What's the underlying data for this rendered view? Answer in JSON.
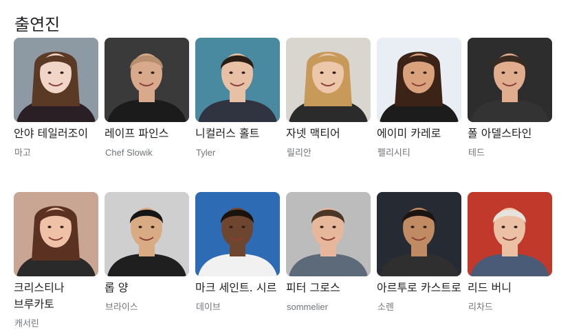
{
  "section": {
    "title": "출연진"
  },
  "cast": [
    {
      "name": "안야 테일러조이",
      "role": "마고",
      "bg": "#8e9aa3",
      "skin": "#f1d6c8",
      "hair": "#5a3a25",
      "shirt": "#2a1f24"
    },
    {
      "name": "레이프 파인스",
      "role": "Chef Slowik",
      "bg": "#3a3a3a",
      "skin": "#d9a98c",
      "hair": "#b88f6e",
      "shirt": "#1b1b1b"
    },
    {
      "name": "니컬러스 홀트",
      "role": "Tyler",
      "bg": "#4a8aa0",
      "skin": "#e8c0a6",
      "hair": "#2a1d16",
      "shirt": "#2f3440"
    },
    {
      "name": "자넷 맥티어",
      "role": "릴리안",
      "bg": "#d9d5cf",
      "skin": "#ecc7a9",
      "hair": "#c79a5a",
      "shirt": "#2b2b2b"
    },
    {
      "name": "에이미 카레로",
      "role": "펠리시티",
      "bg": "#e9eef4",
      "skin": "#d9a27c",
      "hair": "#3b2417",
      "shirt": "#1c1c1c"
    },
    {
      "name": "폴 아델스타인",
      "role": "테드",
      "bg": "#2d2d2d",
      "skin": "#e0ad8e",
      "hair": "#3a2a20",
      "shirt": "#333333"
    },
    {
      "name": "크리스티나 브루카토",
      "role": "캐서린",
      "bg": "#c9a594",
      "skin": "#efc2a8",
      "hair": "#5b3222",
      "shirt": "#2a2a2a"
    },
    {
      "name": "롭 양",
      "role": "브라이스",
      "bg": "#cfcfcf",
      "skin": "#d9ab84",
      "hair": "#151515",
      "shirt": "#1f1f1f"
    },
    {
      "name": "마크 세인트. 시르",
      "role": "데이브",
      "bg": "#2e6bb5",
      "skin": "#6e4630",
      "hair": "#1a120d",
      "shirt": "#f1f1f1"
    },
    {
      "name": "피터 그로스",
      "role": "sommelier",
      "bg": "#bcbcbc",
      "skin": "#e6b79a",
      "hair": "#4a3526",
      "shirt": "#5d6a79"
    },
    {
      "name": "아르투로 카스트로",
      "role": "소렌",
      "bg": "#262b33",
      "skin": "#c08a62",
      "hair": "#1b1410",
      "shirt": "#2f2f2f"
    },
    {
      "name": "리드 버니",
      "role": "리차드",
      "bg": "#c0392b",
      "skin": "#ecc0a4",
      "hair": "#e6e2dc",
      "shirt": "#4a5b78"
    }
  ]
}
